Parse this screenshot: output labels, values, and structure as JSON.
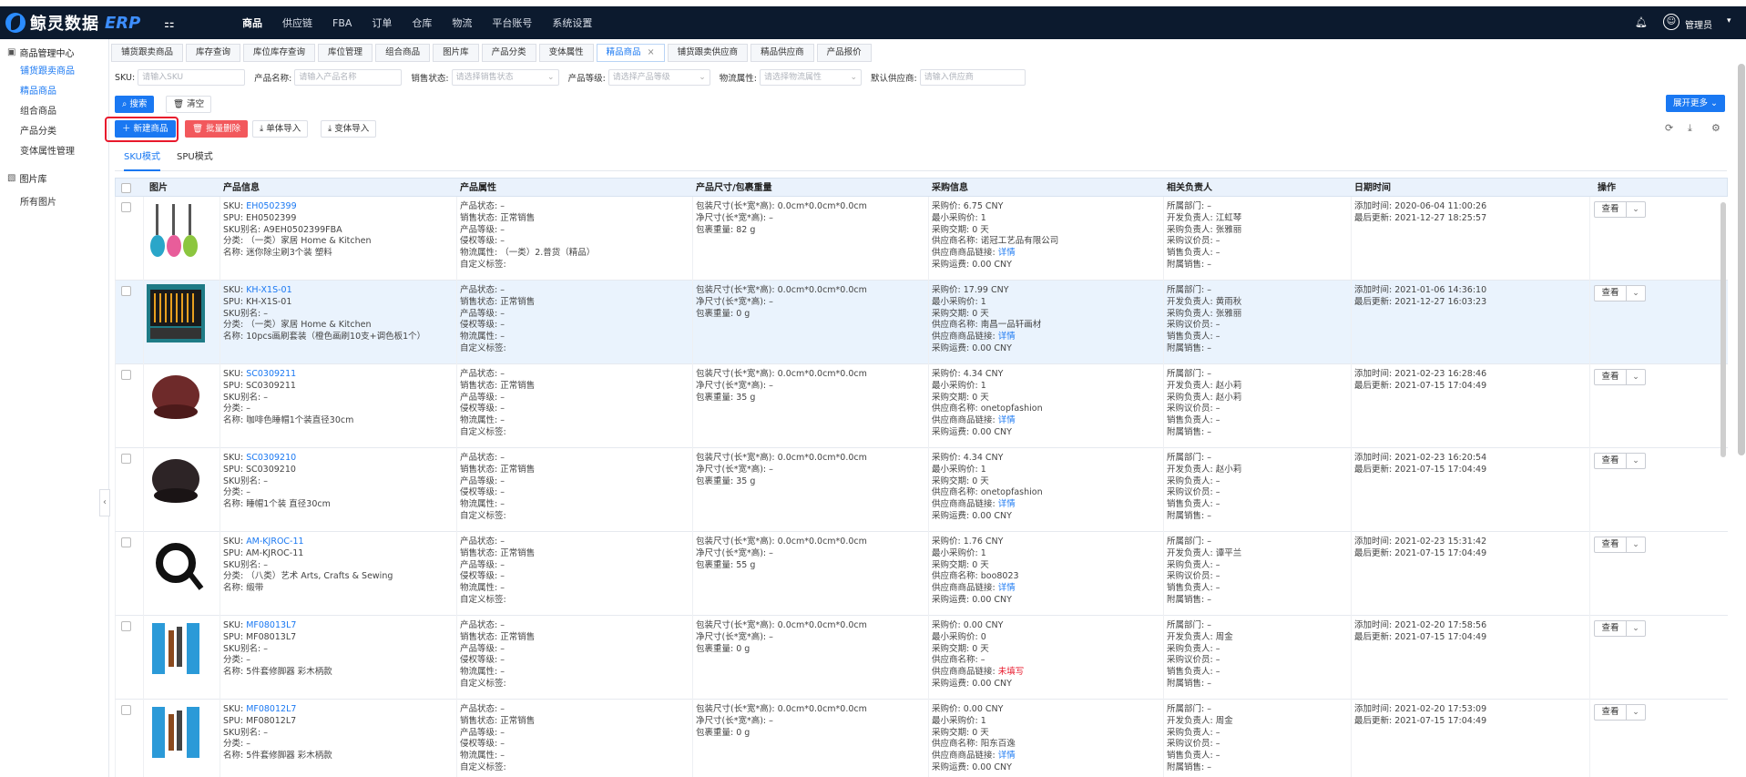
{
  "app": {
    "logo_text": "鲸灵数据",
    "logo_erp": "ERP"
  },
  "nav": [
    "商品",
    "供应链",
    "FBA",
    "订单",
    "仓库",
    "物流",
    "平台账号",
    "系统设置"
  ],
  "user": {
    "name": "管理员"
  },
  "sidebar": {
    "group1": "商品管理中心",
    "items": [
      "铺货跟卖商品",
      "精品商品",
      "组合商品",
      "产品分类",
      "变体属性管理"
    ],
    "group2": "图片库",
    "items2": [
      "所有图片"
    ]
  },
  "pagetabs": [
    "铺货跟卖商品",
    "库存查询",
    "库位库存查询",
    "库位管理",
    "组合商品",
    "图片库",
    "产品分类",
    "变体属性",
    "精品商品",
    "铺货跟卖供应商",
    "精品供应商",
    "产品报价"
  ],
  "filters": {
    "sku_label": "SKU:",
    "sku_ph": "请输入SKU",
    "name_label": "产品名称:",
    "name_ph": "请输入产品名称",
    "status_label": "销售状态:",
    "status_ph": "请选择销售状态",
    "level_label": "产品等级:",
    "level_ph": "请选择产品等级",
    "logistics_label": "物流属性:",
    "logistics_ph": "请选择物流属性",
    "supplier_label": "默认供应商:",
    "supplier_ph": "请输入供应商"
  },
  "buttons": {
    "search": "搜索",
    "clear": "清空",
    "expand": "展开更多",
    "new": "新建商品",
    "batch_delete": "批量删除",
    "single_import": "单体导入",
    "variant_import": "变体导入"
  },
  "modetabs": [
    "SKU模式",
    "SPU模式"
  ],
  "columns": [
    "图片",
    "产品信息",
    "产品属性",
    "产品尺寸/包裹重量",
    "采购信息",
    "相关负责人",
    "日期时间",
    "操作"
  ],
  "row_labels": {
    "info": [
      "SKU:",
      "SPU:",
      "SKU别名:",
      "分类:",
      "名称:"
    ],
    "attr": [
      "产品状态:",
      "销售状态:",
      "产品等级:",
      "侵权等级:",
      "物流属性:",
      "自定义标签:"
    ],
    "size": [
      "包装尺寸(长*宽*高):",
      "净尺寸(长*宽*高):",
      "包裹重量:"
    ],
    "purchase": [
      "采购价:",
      "最小采购价:",
      "采购交期:",
      "供应商名称:",
      "供应商商品链接:",
      "采购运费:"
    ],
    "people": [
      "所属部门:",
      "开发负责人:",
      "采购负责人:",
      "采购议价员:",
      "销售负责人:",
      "附属销售:"
    ],
    "date": [
      "添加时间:",
      "最后更新:"
    ]
  },
  "view_label": "查看",
  "rows": [
    {
      "sku": "EH0502399",
      "spu": "EH0502399",
      "alias": "A9EH0502399FBA",
      "category": "（一类）家居 Home & Kitchen",
      "name": "迷你除尘刷3个装 塑料",
      "attr": [
        "–",
        "正常销售",
        "–",
        "–",
        "（一类）2.普货（精品）",
        ""
      ],
      "size": [
        "0.0cm*0.0cm*0.0cm",
        "–",
        "82 g"
      ],
      "purchase": [
        "6.75 CNY",
        "1",
        "0 天",
        "诺冠工艺品有限公司",
        "详情",
        "0.00 CNY"
      ],
      "link_red": false,
      "people": [
        "–",
        "江虹琴",
        "张雅丽",
        "–",
        "–",
        "–"
      ],
      "date": [
        "2020-06-04 11:00:26",
        "2021-12-27 18:25:57"
      ]
    },
    {
      "sku": "KH-X1S-01",
      "spu": "KH-X1S-01",
      "alias": "–",
      "category": "（一类）家居 Home & Kitchen",
      "name": "10pcs画刷套装（橙色画刷10支+调色板1个）",
      "attr": [
        "–",
        "正常销售",
        "–",
        "–",
        "–",
        ""
      ],
      "size": [
        "0.0cm*0.0cm*0.0cm",
        "–",
        "0 g"
      ],
      "purchase": [
        "17.99 CNY",
        "1",
        "0 天",
        "南昌一品轩画材",
        "详情",
        "0.00 CNY"
      ],
      "link_red": false,
      "people": [
        "–",
        "黄雨秋",
        "张雅丽",
        "–",
        "–",
        "–"
      ],
      "date": [
        "2021-01-06 14:36:10",
        "2021-12-27 16:03:23"
      ]
    },
    {
      "sku": "SC0309211",
      "spu": "SC0309211",
      "alias": "–",
      "category": "–",
      "name": "咖啡色睡帽1个装直径30cm",
      "attr": [
        "–",
        "正常销售",
        "–",
        "–",
        "–",
        ""
      ],
      "size": [
        "0.0cm*0.0cm*0.0cm",
        "–",
        "35 g"
      ],
      "purchase": [
        "4.34 CNY",
        "1",
        "0 天",
        "onetopfashion",
        "详情",
        "0.00 CNY"
      ],
      "link_red": false,
      "people": [
        "–",
        "赵小莉",
        "赵小莉",
        "–",
        "–",
        "–"
      ],
      "date": [
        "2021-02-23 16:28:46",
        "2021-07-15 17:04:49"
      ]
    },
    {
      "sku": "SC0309210",
      "spu": "SC0309210",
      "alias": "–",
      "category": "–",
      "name": "睡帽1个装 直径30cm",
      "attr": [
        "–",
        "正常销售",
        "–",
        "–",
        "–",
        ""
      ],
      "size": [
        "0.0cm*0.0cm*0.0cm",
        "–",
        "35 g"
      ],
      "purchase": [
        "4.34 CNY",
        "1",
        "0 天",
        "onetopfashion",
        "详情",
        "0.00 CNY"
      ],
      "link_red": false,
      "people": [
        "–",
        "赵小莉",
        "–",
        "–",
        "–",
        "–"
      ],
      "date": [
        "2021-02-23 16:20:54",
        "2021-07-15 17:04:49"
      ]
    },
    {
      "sku": "AM-KJROC-11",
      "spu": "AM-KJROC-11",
      "alias": "–",
      "category": "（八类）艺术 Arts, Crafts & Sewing",
      "name": "缎带",
      "attr": [
        "–",
        "正常销售",
        "–",
        "–",
        "–",
        ""
      ],
      "size": [
        "0.0cm*0.0cm*0.0cm",
        "–",
        "55 g"
      ],
      "purchase": [
        "1.76 CNY",
        "1",
        "0 天",
        "boo8023",
        "详情",
        "0.00 CNY"
      ],
      "link_red": false,
      "people": [
        "–",
        "谭平兰",
        "–",
        "–",
        "–",
        "–"
      ],
      "date": [
        "2021-02-23 15:31:42",
        "2021-07-15 17:04:49"
      ]
    },
    {
      "sku": "MF08013L7",
      "spu": "MF08013L7",
      "alias": "–",
      "category": "–",
      "name": "5件套修脚器 彩木柄款",
      "attr": [
        "–",
        "正常销售",
        "–",
        "–",
        "–",
        ""
      ],
      "size": [
        "0.0cm*0.0cm*0.0cm",
        "–",
        "0 g"
      ],
      "purchase": [
        "0.00 CNY",
        "0",
        "0 天",
        "–",
        "未填写",
        "0.00 CNY"
      ],
      "link_red": true,
      "people": [
        "–",
        "周金",
        "–",
        "–",
        "–",
        "–"
      ],
      "date": [
        "2021-02-20 17:58:56",
        "2021-07-15 17:04:49"
      ]
    },
    {
      "sku": "MF08012L7",
      "spu": "MF08012L7",
      "alias": "–",
      "category": "–",
      "name": "5件套修脚器 彩木柄款",
      "attr": [
        "–",
        "正常销售",
        "–",
        "–",
        "–",
        ""
      ],
      "size": [
        "0.0cm*0.0cm*0.0cm",
        "–",
        "0 g"
      ],
      "purchase": [
        "0.00 CNY",
        "1",
        "0 天",
        "阳东百逸",
        "详情",
        "0.00 CNY"
      ],
      "link_red": false,
      "people": [
        "–",
        "周金",
        "–",
        "–",
        "–",
        "–"
      ],
      "date": [
        "2021-02-20 17:53:09",
        "2021-07-15 17:04:49"
      ]
    }
  ]
}
